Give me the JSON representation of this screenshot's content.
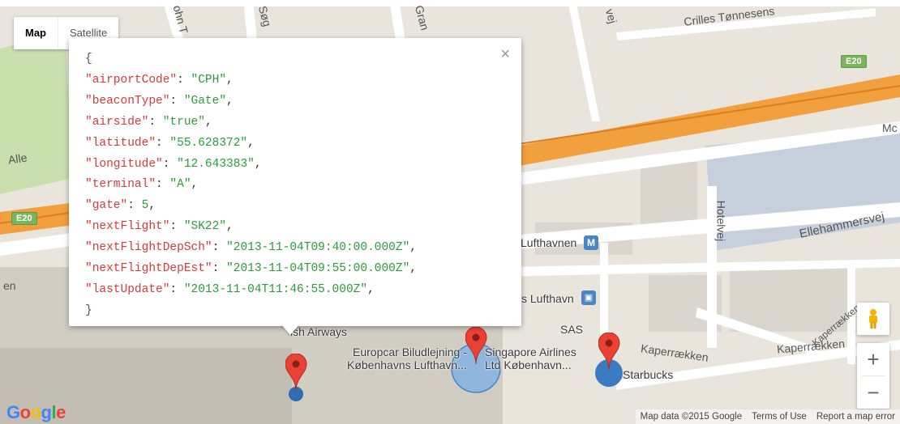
{
  "map_type_control": {
    "map_label": "Map",
    "satellite_label": "Satellite"
  },
  "popup": {
    "close_glyph": "×",
    "open_brace": "{",
    "close_brace": "}",
    "fields": [
      {
        "key": "\"airportCode\"",
        "value": "\"CPH\"",
        "trail": ","
      },
      {
        "key": "\"beaconType\"",
        "value": "\"Gate\"",
        "trail": ","
      },
      {
        "key": "\"airside\"",
        "value": "\"true\"",
        "trail": ","
      },
      {
        "key": "\"latitude\"",
        "value": "\"55.628372\"",
        "trail": ","
      },
      {
        "key": "\"longitude\"",
        "value": "\"12.643383\"",
        "trail": ","
      },
      {
        "key": "\"terminal\"",
        "value": "\"A\"",
        "trail": ","
      },
      {
        "key": "\"gate\"",
        "value": "5",
        "trail": ","
      },
      {
        "key": "\"nextFlight\"",
        "value": "\"SK22\"",
        "trail": ","
      },
      {
        "key": "\"nextFlightDepSch\"",
        "value": "\"2013-11-04T09:40:00.000Z\"",
        "trail": ","
      },
      {
        "key": "\"nextFlightDepEst\"",
        "value": "\"2013-11-04T09:55:00.000Z\"",
        "trail": ","
      },
      {
        "key": "\"lastUpdate\"",
        "value": "\"2013-11-04T11:46:55.000Z\"",
        "trail": ","
      }
    ]
  },
  "map_labels": {
    "streets": {
      "crilles": "Crilles Tønnesens",
      "alle": "Alle",
      "hotelvej": "Hotelvej",
      "ellehammersvej": "Ellehammersvej",
      "kaperraekken1": "Kaperrækken",
      "kaperraekken2": "Kaperrækken",
      "kaperraekken3": "Kaperrækken",
      "en": "en",
      "sog": "Søg",
      "gran": "Gran",
      "ohn": "ohn T",
      "vej": "vej",
      "mc": "Mc"
    },
    "shields": {
      "e20_right": "E20",
      "e20_left": "E20"
    },
    "pois": {
      "lufthavnen_metro": "Lufthavnen",
      "lufthavn_station": "s Lufthavn",
      "british_airways": "ish Airways",
      "sas": "SAS",
      "europcar": "Europcar Biludlejning -\nKøbenhavns Lufthavn...",
      "singapore": "Singapore Airlines\nLtd København...",
      "starbucks": "Starbucks"
    }
  },
  "controls": {
    "zoom_in": "+",
    "zoom_out": "−"
  },
  "branding": {
    "google_logo_letters": [
      "G",
      "o",
      "o",
      "g",
      "l",
      "e"
    ],
    "google_logo_colors": [
      "#4285f4",
      "#ea4335",
      "#fbbc05",
      "#4285f4",
      "#34a853",
      "#ea4335"
    ]
  },
  "footer": {
    "map_data": "Map data ©2015 Google",
    "terms": "Terms of Use",
    "report": "Report a map error"
  },
  "colors": {
    "land": "#e9e5dc",
    "road": "#ffffff",
    "highway": "#f2a03d",
    "building": "#d6d2c8",
    "terminal_building": "#c9c4bb",
    "water": "#b4c6d8",
    "green": "#c9dfae",
    "marker": "#e94235",
    "circle_fill": "#8fb6dc",
    "circle_dot": "#3b7bc4"
  }
}
